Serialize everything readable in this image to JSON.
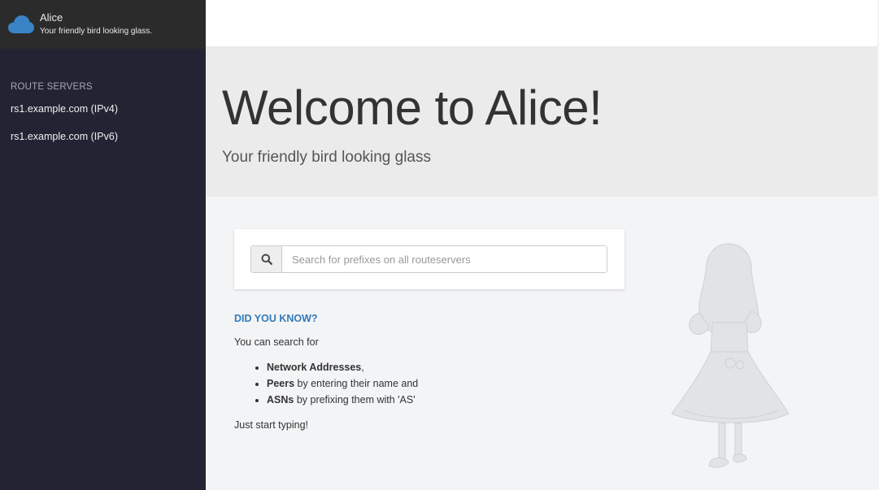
{
  "brand": {
    "title": "Alice",
    "tagline": "Your friendly bird looking glass.",
    "logo_icon": "cloud-icon",
    "logo_color": "#3a84c6"
  },
  "sidebar": {
    "heading": "ROUTE SERVERS",
    "servers": [
      {
        "label": "rs1.example.com (IPv4)"
      },
      {
        "label": "rs1.example.com (IPv6)"
      }
    ]
  },
  "welcome": {
    "title": "Welcome to Alice!",
    "subtitle": "Your friendly bird looking glass"
  },
  "search": {
    "icon": "search-icon",
    "placeholder": "Search for prefixes on all routeservers",
    "value": ""
  },
  "did_you_know": {
    "heading": "DID YOU KNOW?",
    "intro": "You can search for",
    "items": [
      {
        "bold": "Network Addresses",
        "text": ","
      },
      {
        "bold": "Peers",
        "text": " by entering their name and"
      },
      {
        "bold": "ASNs",
        "text": " by prefixing them with 'AS'"
      }
    ],
    "outro": "Just start typing!"
  },
  "colors": {
    "sidebar_bg": "#222434",
    "brand_bg": "#2b2b2b",
    "accent": "#337ab7"
  }
}
